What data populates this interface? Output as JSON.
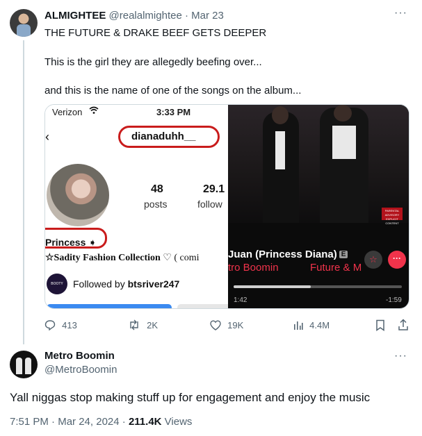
{
  "tweet": {
    "display_name": "ALMIGHTEE",
    "handle": "@realalmightee",
    "separator": "·",
    "date": "Mar 23",
    "more_label": "···",
    "line1": "THE FUTURE & DRAKE BEEF GETS DEEPER",
    "line2": "This is the girl they are allegedly beefing over...",
    "line3": "and this is the name of one of the songs on the album...",
    "media": {
      "instagram": {
        "carrier": "Verizon",
        "wifi_icon": "wifi-icon",
        "time": "3:33 PM",
        "back_glyph": "‹",
        "username": "dianaduhh__",
        "posts_count": "48",
        "posts_label": "posts",
        "followers_count": "29.1",
        "followers_label": "follow",
        "bio_name": "Princess ➧",
        "bio_line_bold": "☆Sadity Fashion Collection",
        "bio_line_rest": " ♡ ( comi",
        "booty_badge": "BOOTY TRAP",
        "followed_prefix": "Followed by ",
        "followed_by": "btsriver247"
      },
      "music": {
        "advisory": "PARENTAL ADVISORY EXPLICIT CONTENT",
        "song_title": "Juan (Princess Diana)",
        "explicit_badge": "E",
        "artist1": "tro Boomin",
        "artist2": "Future & M",
        "star_icon": "☆",
        "more_icon": "···",
        "elapsed": "1:42",
        "remaining": "-1:59",
        "progress": 0.46
      }
    },
    "actions": {
      "replies": "413",
      "reposts": "2K",
      "likes": "19K",
      "views": "4.4M"
    }
  },
  "reply": {
    "display_name": "Metro Boomin",
    "handle": "@MetroBoomin",
    "more_label": "···",
    "text": "Yall niggas stop making stuff up for engagement and enjoy the music",
    "time": "7:51 PM",
    "date": "Mar 24, 2024",
    "sep": " · ",
    "views_count": "211.4K",
    "views_label": " Views"
  },
  "colors": {
    "text": "#0f1419",
    "muted": "#536471",
    "circle_annotation": "#c91c1c",
    "music_accent": "#f0334b"
  }
}
